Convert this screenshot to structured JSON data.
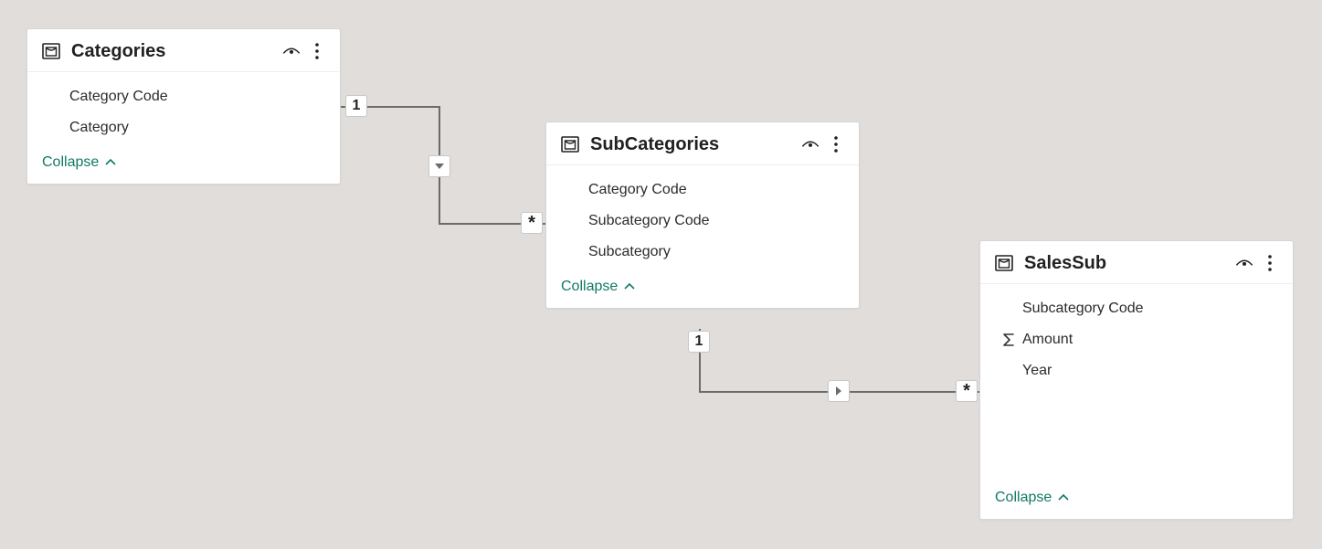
{
  "collapse_label": "Collapse",
  "tables": {
    "categories": {
      "title": "Categories",
      "fields": [
        "Category Code",
        "Category"
      ]
    },
    "subcategories": {
      "title": "SubCategories",
      "fields": [
        "Category Code",
        "Subcategory Code",
        "Subcategory"
      ]
    },
    "salessub": {
      "title": "SalesSub",
      "fields": [
        "Subcategory Code",
        "Amount",
        "Year"
      ]
    }
  },
  "relationships": {
    "r1": {
      "from_card": "1",
      "to_card": "*"
    },
    "r2": {
      "from_card": "1",
      "to_card": "*"
    }
  }
}
